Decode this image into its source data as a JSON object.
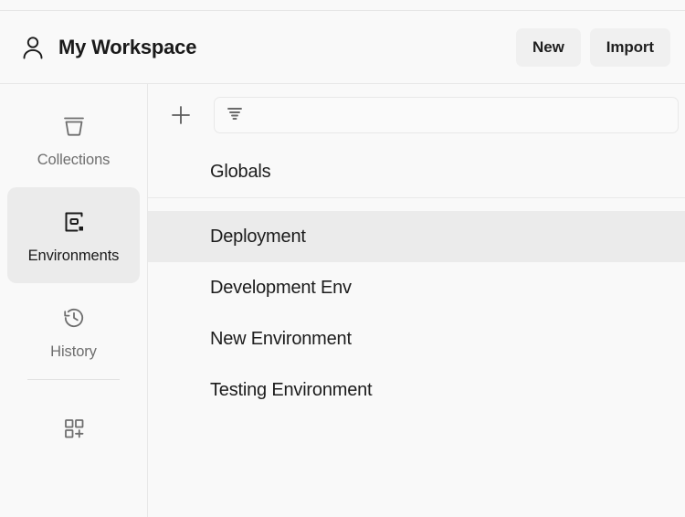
{
  "header": {
    "avatar_icon": "person-icon",
    "workspace_title": "My Workspace",
    "new_label": "New",
    "import_label": "Import"
  },
  "sidebar": {
    "items": [
      {
        "label": "Collections",
        "icon": "collections-icon",
        "active": false
      },
      {
        "label": "Environments",
        "icon": "environments-icon",
        "active": true
      },
      {
        "label": "History",
        "icon": "history-clock-icon",
        "active": false
      }
    ],
    "footer": {
      "icon": "grid-add-icon",
      "label": ""
    }
  },
  "toolbar": {
    "add_icon": "plus-icon",
    "add_label": "",
    "filter_icon": "filter-sort-icon",
    "search_value": "",
    "search_placeholder": ""
  },
  "list": {
    "globals": {
      "label": "Globals"
    },
    "environments": [
      {
        "label": "Deployment",
        "selected": true
      },
      {
        "label": "Development Env",
        "selected": false
      },
      {
        "label": "New Environment",
        "selected": false
      },
      {
        "label": "Testing Environment",
        "selected": false
      }
    ]
  },
  "colors": {
    "background": "#f9f9f9",
    "selected": "#ebebeb",
    "button": "#f0f0f0",
    "border": "#e8e8e8",
    "text": "#1c1c1c",
    "muted": "#6e6e6e"
  }
}
